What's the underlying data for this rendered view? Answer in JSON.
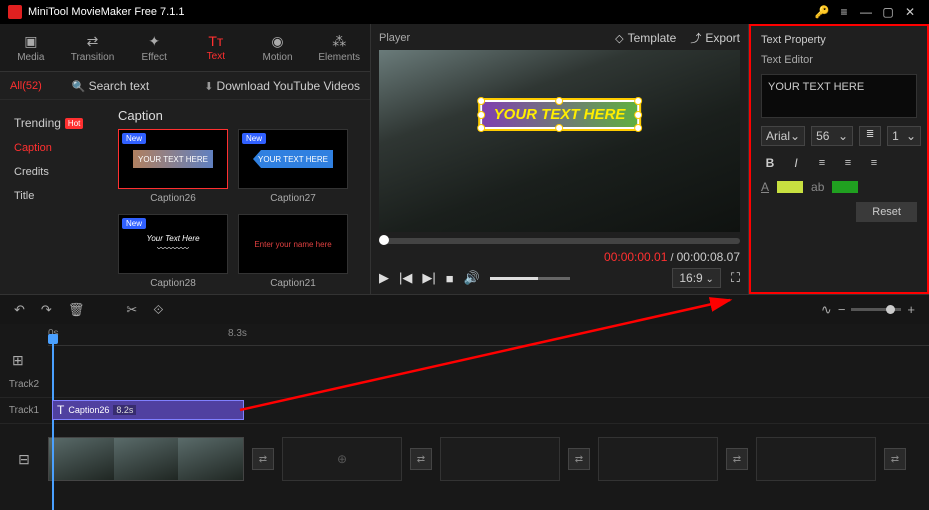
{
  "app": {
    "title": "MiniTool MovieMaker Free 7.1.1"
  },
  "tabs": {
    "media": "Media",
    "transition": "Transition",
    "effect": "Effect",
    "text": "Text",
    "motion": "Motion",
    "elements": "Elements"
  },
  "subbar": {
    "all": "All(52)",
    "search": "Search text",
    "download": "Download YouTube Videos"
  },
  "cats": {
    "trending": "Trending",
    "hot": "Hot",
    "caption": "Caption",
    "credits": "Credits",
    "title": "Title"
  },
  "grid": {
    "title": "Caption",
    "items": [
      {
        "name": "Caption26",
        "text": "YOUR TEXT HERE",
        "new": "New"
      },
      {
        "name": "Caption27",
        "text": "YOUR TEXT HERE",
        "new": "New"
      },
      {
        "name": "Caption28",
        "text": "Your Text Here",
        "new": "New"
      },
      {
        "name": "Caption21",
        "text": "Enter your name here"
      }
    ]
  },
  "player": {
    "title": "Player",
    "template": "Template",
    "export": "Export",
    "overlay": "YOUR TEXT HERE",
    "cur": "00:00:00.01",
    "tot": "00:00:08.07",
    "aspect": "16:9"
  },
  "prop": {
    "title": "Text Property",
    "editor": "Text Editor",
    "value": "YOUR TEXT HERE",
    "font": "Arial",
    "size": "56",
    "lineheight": "1",
    "reset": "Reset",
    "color1": "#c8e040",
    "color2": "#20a020"
  },
  "tl": {
    "t0": "0s",
    "t1": "8.3s",
    "track2": "Track2",
    "track1": "Track1",
    "clip": {
      "name": "Caption26",
      "dur": "8.2s"
    }
  }
}
